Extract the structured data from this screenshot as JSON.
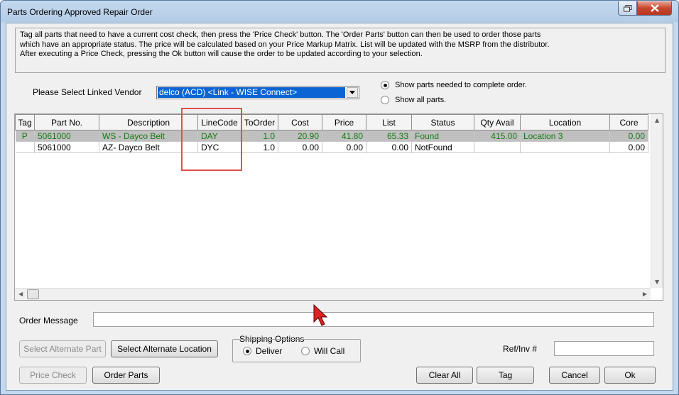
{
  "window": {
    "title": "Parts Ordering Approved Repair Order"
  },
  "info_lines": [
    "Tag all parts that need to have a current cost check, then press the 'Price Check' button.  The 'Order Parts' button can then be used to order those parts",
    "which have an appropriate status.  The price will be calculated based on your Price Markup Matrix. List will be updated with the MSRP from the distributor.",
    "After executing a Price Check, pressing the Ok button will cause the order to be updated according to your selection."
  ],
  "vendor": {
    "label": "Please Select Linked Vendor",
    "selected": "delco (ACD) <Link - WISE Connect>"
  },
  "filter": {
    "option1": "Show parts needed to complete order.",
    "option2": "Show all parts.",
    "selected": "option1"
  },
  "grid": {
    "columns": [
      "Tag",
      "Part No.",
      "Description",
      "LineCode",
      "ToOrder",
      "Cost",
      "Price",
      "List",
      "Status",
      "Qty Avail",
      "Location",
      "Core"
    ],
    "rows": [
      {
        "tag": "P",
        "part_no": "5061000",
        "description": "WS - Dayco Belt",
        "line_code": "DAY",
        "to_order": "1.0",
        "cost": "20.90",
        "price": "41.80",
        "list": "65.33",
        "status": "Found",
        "qty_avail": "415.00",
        "location": "Location 3",
        "core": "0.00",
        "selected": true
      },
      {
        "tag": "",
        "part_no": "5061000",
        "description": "AZ- Dayco Belt",
        "line_code": "DYC",
        "to_order": "1.0",
        "cost": "0.00",
        "price": "0.00",
        "list": "0.00",
        "status": "NotFound",
        "qty_avail": "",
        "location": "",
        "core": "0.00",
        "selected": false
      }
    ]
  },
  "order_message": {
    "label": "Order Message",
    "value": ""
  },
  "buttons": {
    "select_alt_part": "Select Alternate Part",
    "select_alt_location": "Select Alternate Location",
    "price_check": "Price Check",
    "order_parts": "Order Parts",
    "clear_all": "Clear All",
    "tag": "Tag",
    "cancel": "Cancel",
    "ok": "Ok"
  },
  "shipping": {
    "title": "Shipping Options",
    "deliver": "Deliver",
    "will_call": "Will Call",
    "selected": "deliver"
  },
  "ref_inv": {
    "label": "Ref/Inv #",
    "value": ""
  },
  "colors": {
    "selection_blue": "#0a64d4",
    "found_green": "#137a13",
    "annotation_red": "#e0514e"
  }
}
